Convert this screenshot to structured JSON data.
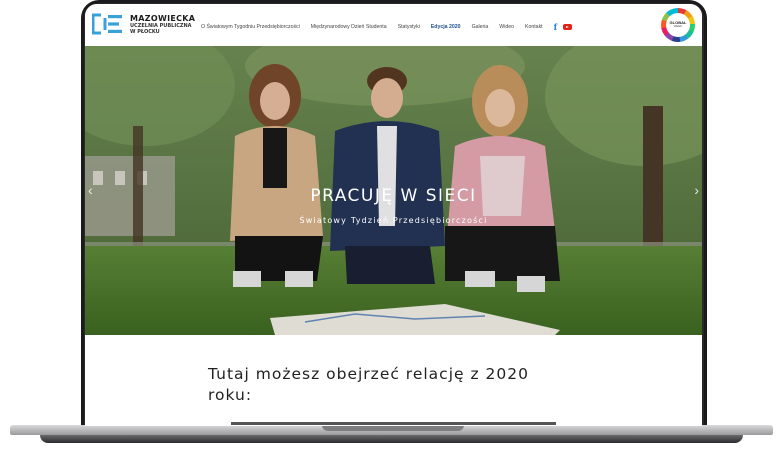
{
  "brand": {
    "line1": "MAZOWIECKA",
    "line2": "UCZELNIA PUBLICZNA",
    "line3": "W PŁOCKU"
  },
  "nav": {
    "items": [
      {
        "label": "O Światowym Tygodniu Przedsiębiorczości"
      },
      {
        "label": "Międzynarodowy Dzień Studenta"
      },
      {
        "label": "Statystyki"
      },
      {
        "label": "Edycja 2020",
        "active": true
      },
      {
        "label": "Galeria"
      },
      {
        "label": "Wideo"
      },
      {
        "label": "Kontakt"
      }
    ],
    "social": [
      "facebook-icon",
      "youtube-icon"
    ]
  },
  "badge": {
    "line1": "GLOBAL",
    "line2": "WEEK"
  },
  "hero": {
    "title": "PRACUJĘ W SIECI",
    "subtitle": "Światowy Tydzień Przedsiębiorczości"
  },
  "content": {
    "heading": "Tutaj możesz obejrzeć relację z 2020 roku:"
  },
  "colors": {
    "accent": "#1d4f91",
    "facebook": "#1877f2",
    "youtube": "#e62117"
  }
}
